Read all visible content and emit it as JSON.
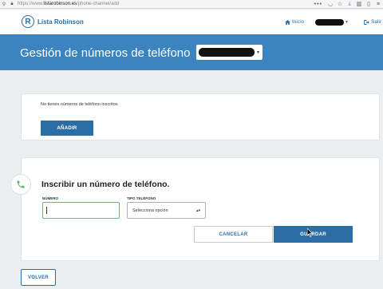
{
  "browser": {
    "url_prefix": "https://www.",
    "url_host": "listarobinson.es",
    "url_path": "/phone-channel/add",
    "menu_dots": "•••"
  },
  "header": {
    "logo_mark": "R",
    "logo_text": "Lista Robinson",
    "home_label": "Inicio",
    "exit_label": "Salir",
    "user_name_redacted": true
  },
  "banner": {
    "title": "Gestión de números de teléfono",
    "phone_select_redacted": true
  },
  "list_panel": {
    "empty_text": "No tienes números de teléfono inscritos",
    "add_button": "AÑADIR"
  },
  "form": {
    "title": "Inscribir un número de teléfono.",
    "number_label": "NÚMERO",
    "number_value": "",
    "type_label": "TIPO TELÉFONO",
    "type_selected": "Selecciona opción",
    "cancel_button": "CANCELAR",
    "save_button": "GUARDAR"
  },
  "back_button": "VOLVER",
  "colors": {
    "brand_blue": "#2b6ea6",
    "banner_blue": "#3b84c0",
    "page_bg": "#eceeef",
    "phone_icon_green": "#5cb85c"
  }
}
